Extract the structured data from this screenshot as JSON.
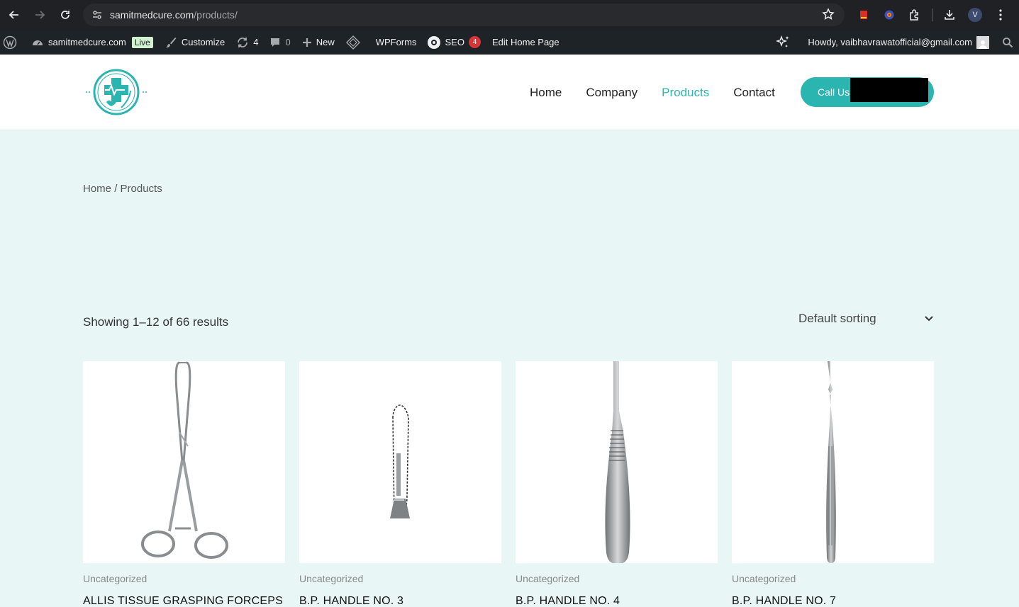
{
  "browser": {
    "url_host": "samitmedcure.com",
    "url_path": "/products/",
    "profile_initial": "V"
  },
  "adminbar": {
    "site_name": "samitmedcure.com",
    "live_label": "Live",
    "customize_label": "Customize",
    "updates_count": "4",
    "comments_count": "0",
    "new_label": "New",
    "wpforms_label": "WPForms",
    "seo_label": "SEO",
    "seo_count": "4",
    "edit_label": "Edit Home Page",
    "howdy_text": "Howdy, vaibhavrawatofficial@gmail.com"
  },
  "header": {
    "nav": [
      "Home",
      "Company",
      "Products",
      "Contact"
    ],
    "active_nav": "Products",
    "call_label": "Call Us:"
  },
  "breadcrumb": {
    "home": "Home",
    "separator": "/",
    "current": "Products"
  },
  "shop": {
    "result_count": "Showing 1–12 of 66 results",
    "sorting_value": "Default sorting"
  },
  "products": [
    {
      "category": "Uncategorized",
      "title": "ALLIS TISSUE GRASPING FORCEPS",
      "image": "forceps"
    },
    {
      "category": "Uncategorized",
      "title": "B.P. HANDLE NO. 3",
      "image": "bp-handle-3"
    },
    {
      "category": "Uncategorized",
      "title": "B.P. HANDLE NO. 4",
      "image": "bp-handle-4"
    },
    {
      "category": "Uncategorized",
      "title": "B.P. HANDLE NO. 7",
      "image": "bp-handle-7"
    }
  ],
  "colors": {
    "accent": "#2bb5b0",
    "page_bg": "#e8f7f6",
    "adminbar_bg": "#1d2327",
    "chrome_bg": "#202124"
  }
}
